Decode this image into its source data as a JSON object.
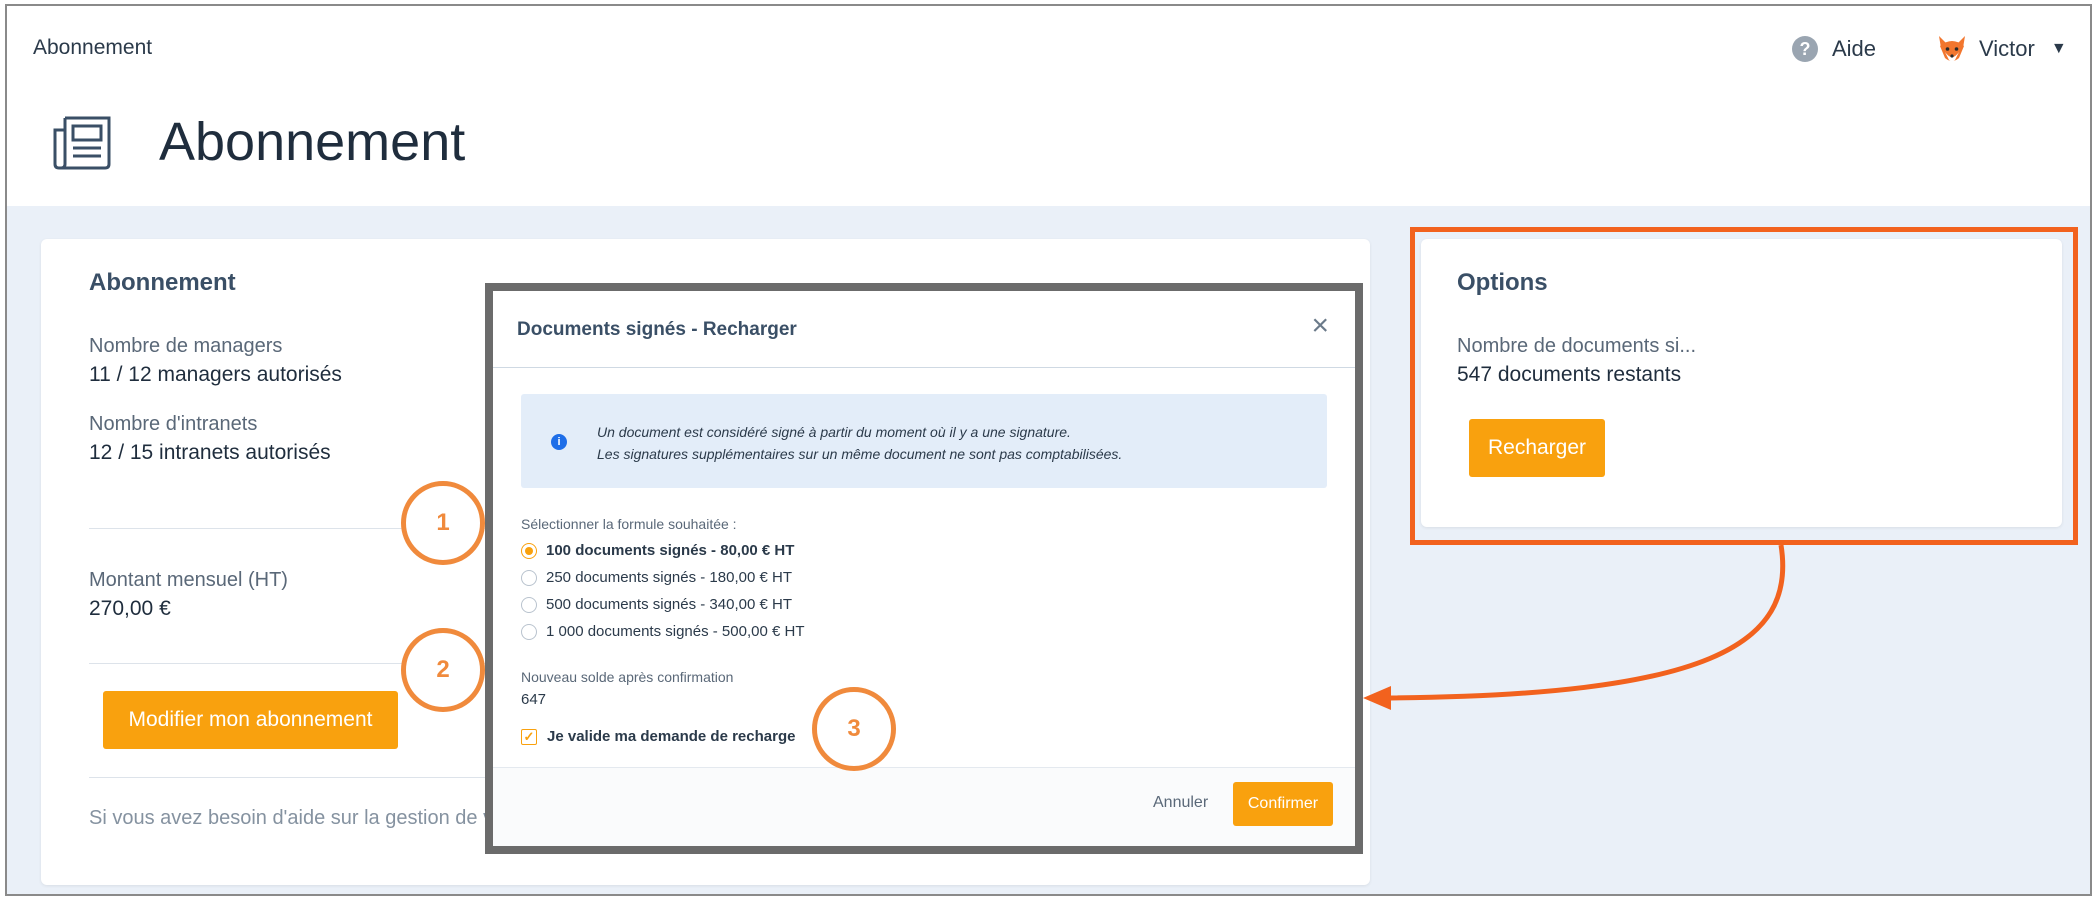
{
  "header": {
    "breadcrumb": "Abonnement",
    "help_label": "Aide",
    "help_icon_glyph": "?",
    "user_name": "Victor",
    "page_title": "Abonnement"
  },
  "subscription_card": {
    "title": "Abonnement",
    "managers_label": "Nombre de managers",
    "managers_value": "11 / 12 managers autorisés",
    "intranets_label": "Nombre d'intranets",
    "intranets_value": "12 / 15 intranets autorisés",
    "monthly_label": "Montant mensuel (HT)",
    "monthly_value": "270,00 €",
    "modify_button": "Modifier mon abonnement",
    "help_text": "Si vous avez besoin d'aide sur la gestion de vo"
  },
  "options_card": {
    "title": "Options",
    "docs_label": "Nombre de documents si...",
    "docs_value": "547 documents restants",
    "recharge_button": "Recharger"
  },
  "modal": {
    "title": "Documents signés - Recharger",
    "close_glyph": "×",
    "info_glyph": "i",
    "info_line1": "Un document est considéré signé à partir du moment où il y a une signature.",
    "info_line2": "Les signatures supplémentaires sur un même document ne sont pas comptabilisées.",
    "select_label": "Sélectionner la formule souhaitée :",
    "options": [
      {
        "label": "100 documents signés - 80,00 € HT",
        "selected": true
      },
      {
        "label": "250 documents signés - 180,00 € HT",
        "selected": false
      },
      {
        "label": "500 documents signés - 340,00 € HT",
        "selected": false
      },
      {
        "label": "1 000 documents signés - 500,00 € HT",
        "selected": false
      }
    ],
    "new_balance_label": "Nouveau solde après confirmation",
    "new_balance_value": "647",
    "confirm_check_label": "Je valide ma demande de recharge",
    "confirm_check_checked": true,
    "cancel_button": "Annuler",
    "confirm_button": "Confirmer"
  },
  "annotations": {
    "markers": [
      "1",
      "2",
      "3"
    ],
    "highlight_color": "#f2621e"
  },
  "colors": {
    "accent": "#f9a10e",
    "background": "#eaf0f8",
    "info_background": "#e3edf9"
  }
}
